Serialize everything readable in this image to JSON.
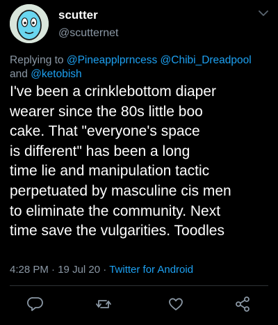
{
  "tweet": {
    "display_name": "scutter",
    "handle": "@scutternet",
    "replying_prefix": "Replying to",
    "mentions": [
      "@Pineapplprncess",
      "@Chibi_Dreadpool",
      "@ketobish"
    ],
    "and_word": "and",
    "text_lines": [
      "I've been a crinklebottom diaper",
      "wearer since the 80s little boo",
      "cake. That \"everyone's space",
      "is different\" has been a long",
      "time lie and manipulation tactic",
      "perpetuated by masculine cis men",
      "to eliminate the community. Next",
      "time save the vulgarities. Toodles"
    ],
    "time": "4:28 PM",
    "date": "19 Jul 20",
    "separator": "·",
    "source": "Twitter for Android"
  },
  "icons": {
    "avatar": "cartoon-face-avatar",
    "menu": "chevron-down-icon",
    "reply": "reply-icon",
    "retweet": "retweet-icon",
    "like": "heart-icon",
    "share": "share-icon"
  },
  "colors": {
    "background": "#000000",
    "text": "#ffffff",
    "secondary": "#8b98a5",
    "link": "#1da1f2",
    "divider": "#2f3336"
  }
}
